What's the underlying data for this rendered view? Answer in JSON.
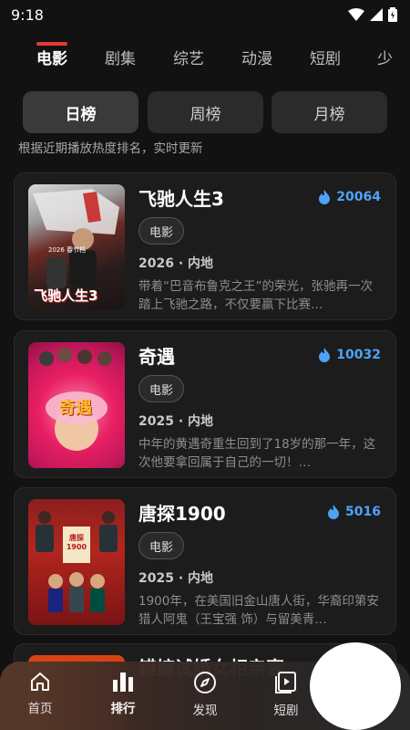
{
  "status": {
    "time": "9:18"
  },
  "tabs": [
    "电影",
    "剧集",
    "综艺",
    "动漫",
    "短剧",
    "少"
  ],
  "segments": [
    "日榜",
    "周榜",
    "月榜"
  ],
  "hint": "根据近期播放热度排名，实时更新",
  "cards": [
    {
      "title": "飞驰人生3",
      "heat": "20064",
      "tag": "电影",
      "meta": "2026 · 内地",
      "desc": "带着“巴音布鲁克之王”的荣光，张驰再一次踏上飞驰之路，不仅要赢下比赛…",
      "poster_text": "飞驰人生3",
      "poster_small": "2026 春节档"
    },
    {
      "title": "奇遇",
      "heat": "10032",
      "tag": "电影",
      "meta": "2025 · 内地",
      "desc": "中年的黄遇奇重生回到了18岁的那一年，这次他要拿回属于自己的一切！…",
      "poster_text": "奇遇"
    },
    {
      "title": "唐探1900",
      "heat": "5016",
      "tag": "电影",
      "meta": "2025 · 内地",
      "desc": "1900年，在美国旧金山唐人街，华裔印第安猎人阿鬼（王宝强 饰）与留美青…",
      "poster_text": "唐探1900"
    }
  ],
  "peek_title": "错嫁试婚女相亲宴",
  "nav": [
    {
      "label": "首页",
      "icon": "home-icon"
    },
    {
      "label": "排行",
      "icon": "bar-chart-icon"
    },
    {
      "label": "发现",
      "icon": "compass-icon"
    },
    {
      "label": "短剧",
      "icon": "play-book-icon"
    }
  ]
}
